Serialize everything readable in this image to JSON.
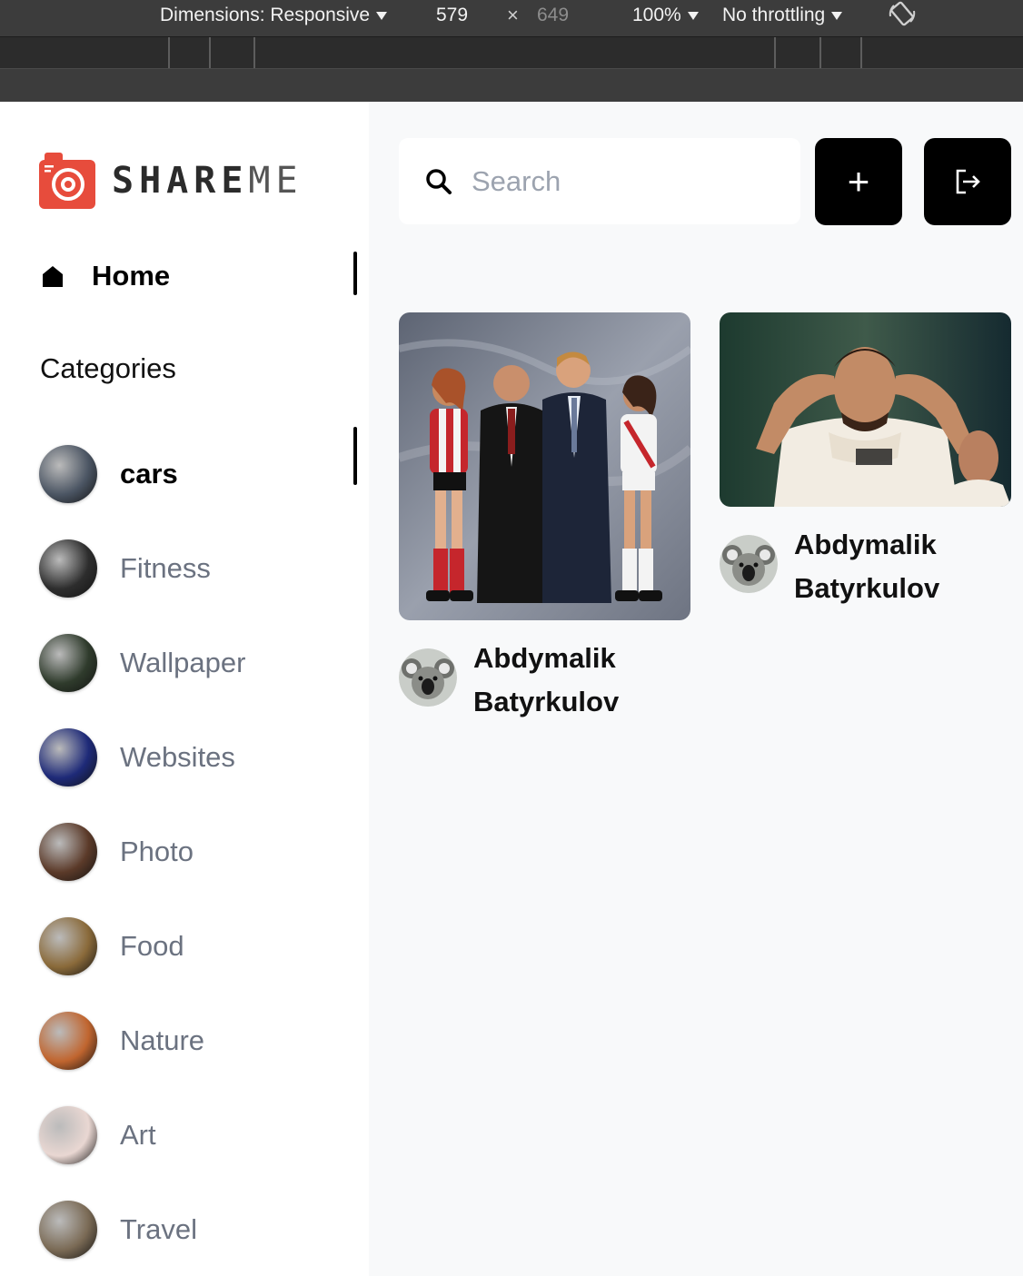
{
  "devtools": {
    "dimensions_label": "Dimensions: Responsive",
    "width": "579",
    "times": "×",
    "height": "649",
    "zoom": "100%",
    "throttling": "No throttling",
    "rotate_icon": "rotate-icon"
  },
  "sidebar": {
    "logo": {
      "icon": "camera-icon",
      "text_bold": "SHARE",
      "text_thin": "ME",
      "brand_color": "#e74c3c"
    },
    "home": {
      "icon": "home-icon",
      "label": "Home"
    },
    "categories_title": "Categories",
    "categories": [
      {
        "label": "cars",
        "active": true,
        "thumb_color": "#4b5563"
      },
      {
        "label": "Fitness",
        "active": false,
        "thumb_color": "#2d2d2d"
      },
      {
        "label": "Wallpaper",
        "active": false,
        "thumb_color": "#2f3b2c"
      },
      {
        "label": "Websites",
        "active": false,
        "thumb_color": "#1e2a78"
      },
      {
        "label": "Photo",
        "active": false,
        "thumb_color": "#5b3a29"
      },
      {
        "label": "Food",
        "active": false,
        "thumb_color": "#8a6a3a"
      },
      {
        "label": "Nature",
        "active": false,
        "thumb_color": "#c0652f"
      },
      {
        "label": "Art",
        "active": false,
        "thumb_color": "#e9d7d2"
      },
      {
        "label": "Travel",
        "active": false,
        "thumb_color": "#7a6a55"
      }
    ]
  },
  "header": {
    "search_placeholder": "Search",
    "search_icon": "search-icon",
    "add_icon": "plus-icon",
    "add_label": "+",
    "logout_icon": "logout-icon"
  },
  "pins": [
    {
      "user": "Abdymalik Batyrkulov",
      "avatar_icon": "koala-avatar",
      "image": "team-photo"
    },
    {
      "user": "Abdymalik Batyrkulov",
      "avatar_icon": "koala-avatar",
      "image": "football-player"
    }
  ]
}
